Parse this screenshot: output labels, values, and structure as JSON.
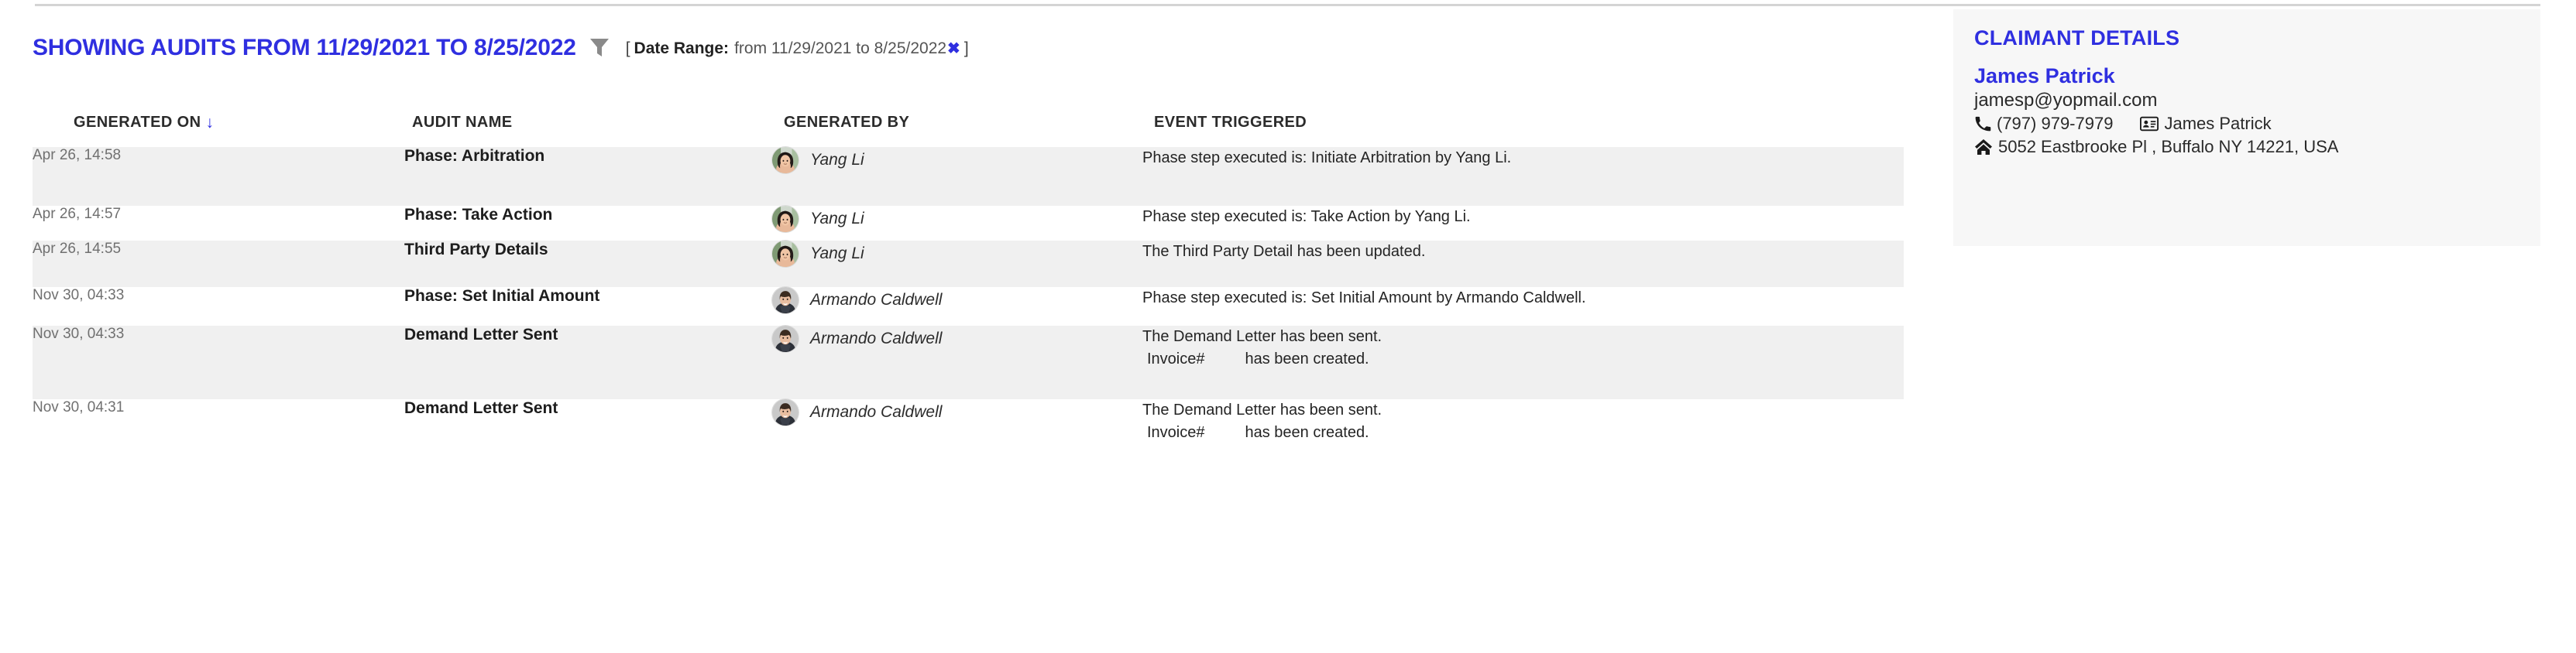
{
  "header": {
    "showing_title": "SHOWING AUDITS FROM 11/29/2021 TO 8/25/2022",
    "filter_icon": "funnel-filter-icon",
    "bracket_open": "[",
    "bracket_close": "]",
    "chip_label": "Date Range:",
    "chip_value": "from 11/29/2021 to 8/25/2022",
    "chip_clear": "✖"
  },
  "table": {
    "columns": [
      {
        "key": "generated_on",
        "label": "GENERATED ON",
        "sort_icon": "↓",
        "sorted": true
      },
      {
        "key": "audit_name",
        "label": "AUDIT NAME",
        "sort_icon": "",
        "sorted": false
      },
      {
        "key": "generated_by",
        "label": "GENERATED BY",
        "sort_icon": "",
        "sorted": false
      },
      {
        "key": "event_triggered",
        "label": "EVENT TRIGGERED",
        "sort_icon": "",
        "sorted": false
      }
    ],
    "rows": [
      {
        "generated_on": "Apr 26, 14:58",
        "audit_name": "Phase: Arbitration",
        "generated_by": "Yang Li",
        "avatar": "avatar-yang-li",
        "event_line1": "Phase step executed is: Initiate Arbitration by Yang Li.",
        "event_line2": "",
        "event_line2_suffix": ""
      },
      {
        "generated_on": "Apr 26, 14:57",
        "audit_name": "Phase: Take Action",
        "generated_by": "Yang Li",
        "avatar": "avatar-yang-li",
        "event_line1": "Phase step executed is: Take Action by Yang Li.",
        "event_line2": "",
        "event_line2_suffix": ""
      },
      {
        "generated_on": "Apr 26, 14:55",
        "audit_name": "Third Party Details",
        "generated_by": "Yang Li",
        "avatar": "avatar-yang-li",
        "event_line1": "The Third Party Detail has been updated.",
        "event_line2": "",
        "event_line2_suffix": ""
      },
      {
        "generated_on": "Nov 30, 04:33",
        "audit_name": "Phase: Set Initial Amount",
        "generated_by": "Armando Caldwell",
        "avatar": "avatar-armando-caldwell",
        "event_line1": "Phase step executed is: Set Initial Amount by Armando Caldwell.",
        "event_line2": "",
        "event_line2_suffix": ""
      },
      {
        "generated_on": "Nov 30, 04:33",
        "audit_name": "Demand Letter Sent",
        "generated_by": "Armando Caldwell",
        "avatar": "avatar-armando-caldwell",
        "event_line1": "The Demand Letter has been sent.",
        "event_line2": "Invoice#",
        "event_line2_suffix": "has been created."
      },
      {
        "generated_on": "Nov 30, 04:31",
        "audit_name": "Demand Letter Sent",
        "generated_by": "Armando Caldwell",
        "avatar": "avatar-armando-caldwell",
        "event_line1": "The Demand Letter has been sent.",
        "event_line2": "Invoice#",
        "event_line2_suffix": "has been created."
      }
    ]
  },
  "claimant": {
    "title": "CLAIMANT DETAILS",
    "name": "James Patrick",
    "email": "jamesp@yopmail.com",
    "phone": "(797) 979-7979",
    "contact_name": "James Patrick",
    "address": "5052 Eastbrooke Pl , Buffalo NY 14221, USA",
    "phone_icon": "phone-icon",
    "id-card_icon": "id-card-icon",
    "home_icon": "home-icon"
  },
  "colors": {
    "accent_blue": "#2f2fe0",
    "row_stripe": "#f0f0f0",
    "panel_bg": "#f7f7f7",
    "divider": "#d4d4d4",
    "funnel_gray": "#808080"
  }
}
